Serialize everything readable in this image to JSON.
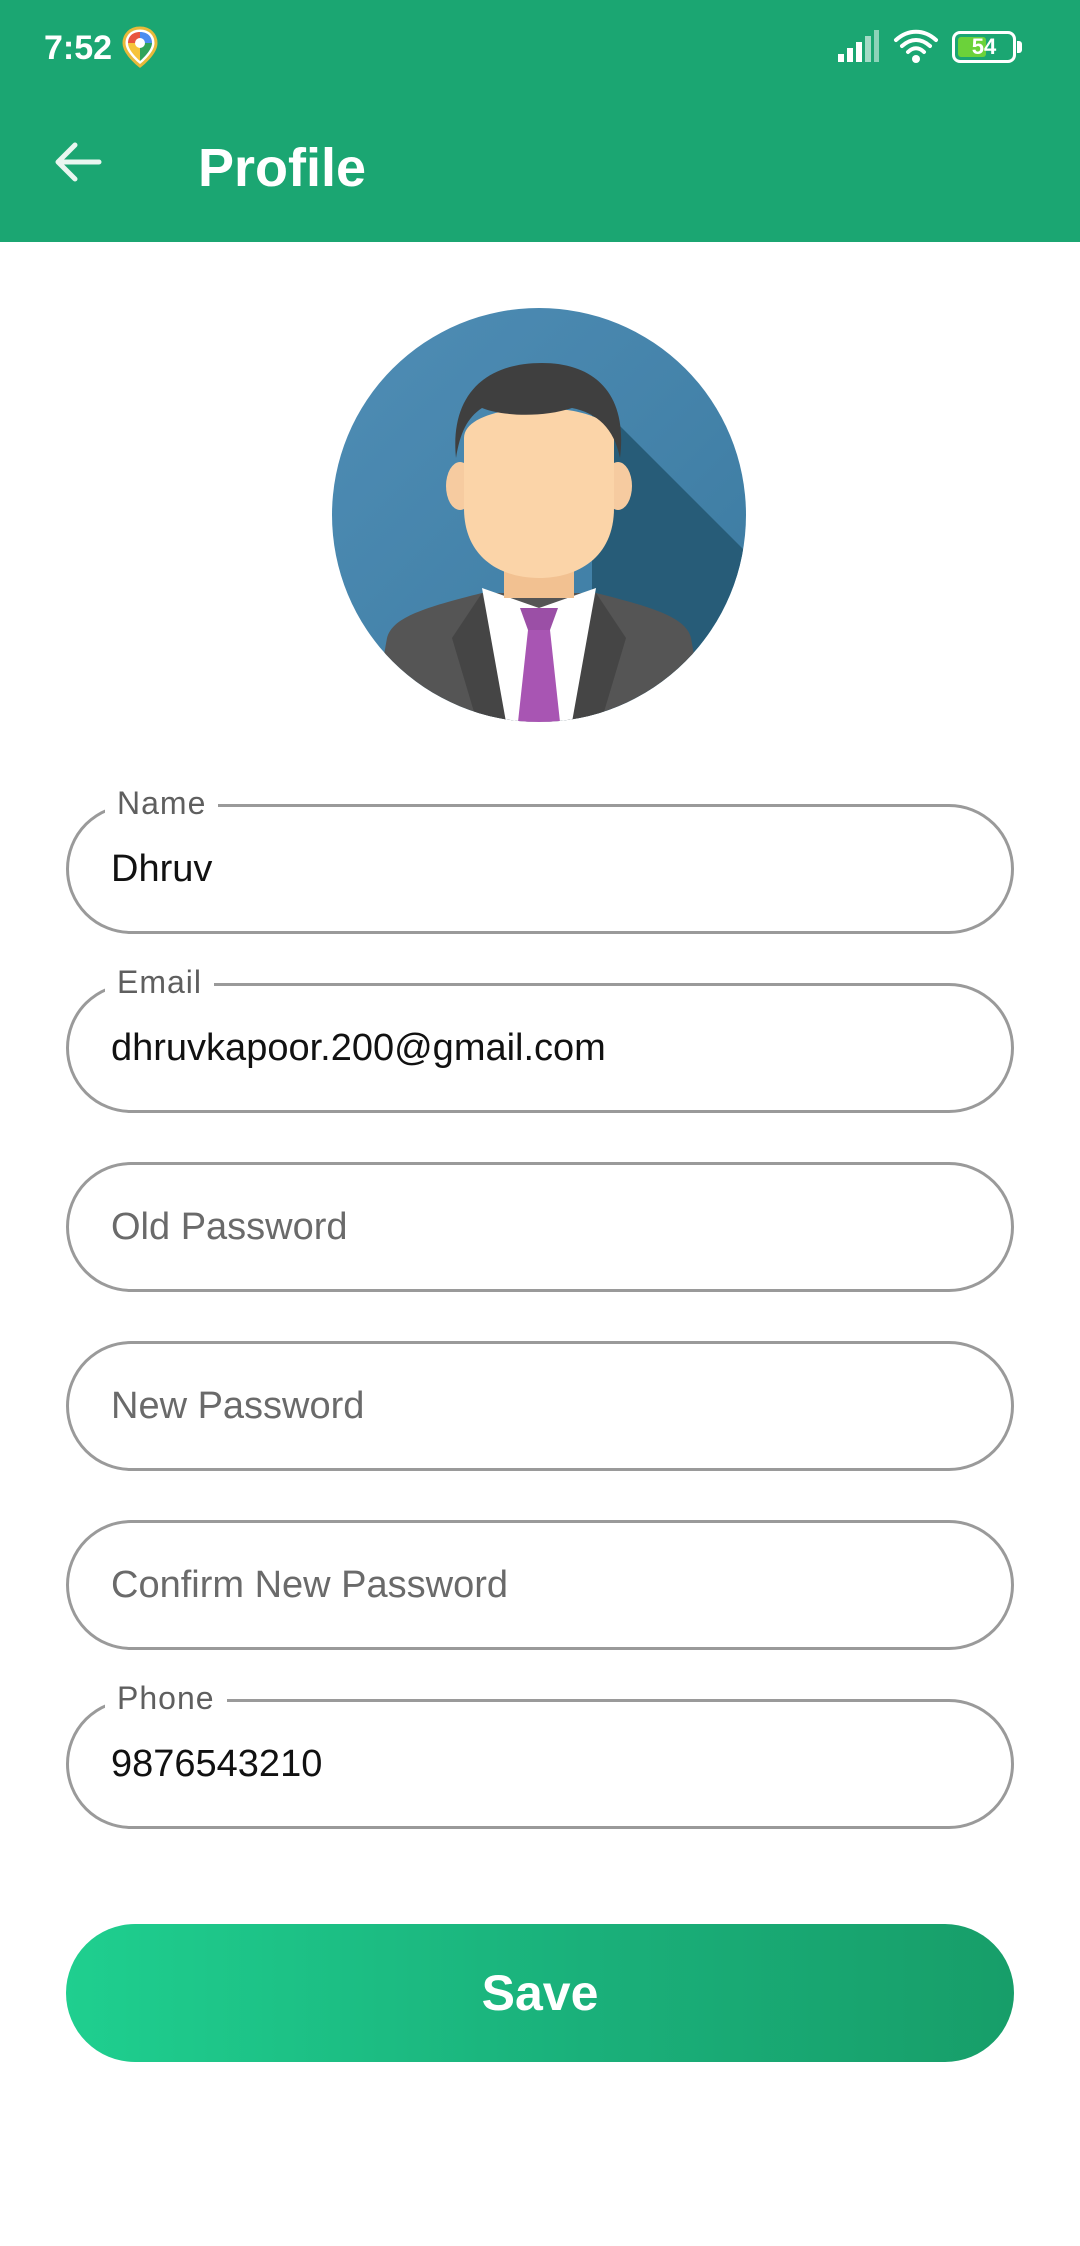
{
  "status_bar": {
    "time": "7:52",
    "battery_level": "54",
    "maps_icon": "google-maps-icon",
    "signal_icon": "cellular-signal-icon",
    "wifi_icon": "wifi-icon"
  },
  "app_bar": {
    "title": "Profile",
    "back_icon": "arrow-back-icon",
    "color": "#1ba672"
  },
  "avatar": {
    "icon": "user-avatar-icon"
  },
  "form": {
    "name": {
      "label": "Name",
      "value": "Dhruv"
    },
    "email": {
      "label": "Email",
      "value": "dhruvkapoor.200@gmail.com"
    },
    "old_password": {
      "placeholder": "Old Password"
    },
    "new_password": {
      "placeholder": "New Password"
    },
    "confirm_password": {
      "placeholder": "Confirm New Password"
    },
    "phone": {
      "label": "Phone",
      "value": "9876543210"
    }
  },
  "save_button": {
    "label": "Save",
    "gradient_start": "#1fcf8f",
    "gradient_end": "#179e69"
  }
}
